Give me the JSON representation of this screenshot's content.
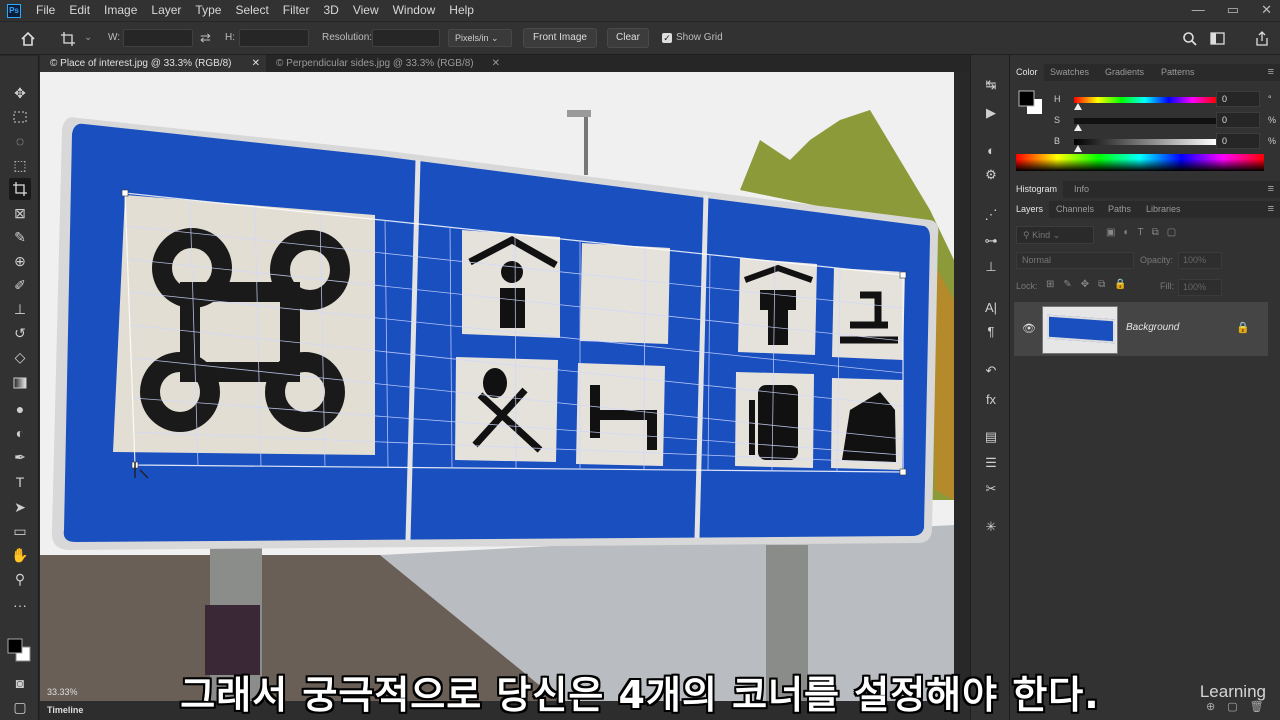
{
  "menubar": {
    "logo": "Ps",
    "items": [
      "File",
      "Edit",
      "Image",
      "Layer",
      "Type",
      "Select",
      "Filter",
      "3D",
      "View",
      "Window",
      "Help"
    ],
    "window_controls": [
      "—",
      "▭",
      "✕"
    ]
  },
  "options": {
    "w_label": "W:",
    "h_label": "H:",
    "resolution_label": "Resolution:",
    "units": "Pixels/in",
    "front_image": "Front Image",
    "clear": "Clear",
    "show_grid": "Show Grid",
    "show_grid_checked": true
  },
  "tabs": [
    {
      "label": "© Place of interest.jpg @ 33.3% (RGB/8)",
      "active": true
    },
    {
      "label": "© Perpendicular sides.jpg @ 33.3% (RGB/8)",
      "active": false
    }
  ],
  "status": {
    "zoom": "33.33%",
    "timeline": "Timeline"
  },
  "color_panel": {
    "tabs": [
      "Color",
      "Swatches",
      "Gradients",
      "Patterns"
    ],
    "h": {
      "label": "H",
      "value": "0",
      "unit": "°"
    },
    "s": {
      "label": "S",
      "value": "0",
      "unit": "%"
    },
    "b": {
      "label": "B",
      "value": "0",
      "unit": "%"
    },
    "foreground": "#000000",
    "background": "#ffffff"
  },
  "histogram_tabs": [
    "Histogram",
    "Info"
  ],
  "layers_panel": {
    "tabs": [
      "Layers",
      "Channels",
      "Paths",
      "Libraries"
    ],
    "kind": "Kind",
    "blend_mode": "Normal",
    "opacity_label": "Opacity:",
    "opacity_value": "100%",
    "lock_label": "Lock:",
    "fill_label": "Fill:",
    "fill_value": "100%",
    "layer_name": "Background"
  },
  "subtitle": "그래서 궁극적으로 당신은 4개의 코너를 설정해야 한다.",
  "watermark": "Learning"
}
